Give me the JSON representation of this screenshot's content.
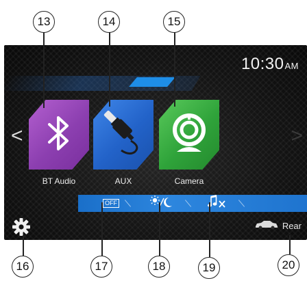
{
  "status": {
    "time": "10:30",
    "ampm": "AM"
  },
  "tiles": [
    {
      "label": "BT Audio",
      "icon": "bluetooth-icon",
      "color": "#9a4ac0"
    },
    {
      "label": "AUX",
      "icon": "aux-cable-icon",
      "color": "#2a6fd6"
    },
    {
      "label": "Camera",
      "icon": "camera-icon",
      "color": "#33a83d"
    }
  ],
  "bottom_bar": {
    "display_off_label": "OFF",
    "items": [
      "display-off-icon",
      "day-night-icon",
      "mute-icon"
    ],
    "camera_label": "Rear"
  },
  "callouts": [
    "13",
    "14",
    "15",
    "16",
    "17",
    "18",
    "19",
    "20"
  ],
  "colors": {
    "accent": "#1e8ee8",
    "bar": "#2d86de"
  }
}
